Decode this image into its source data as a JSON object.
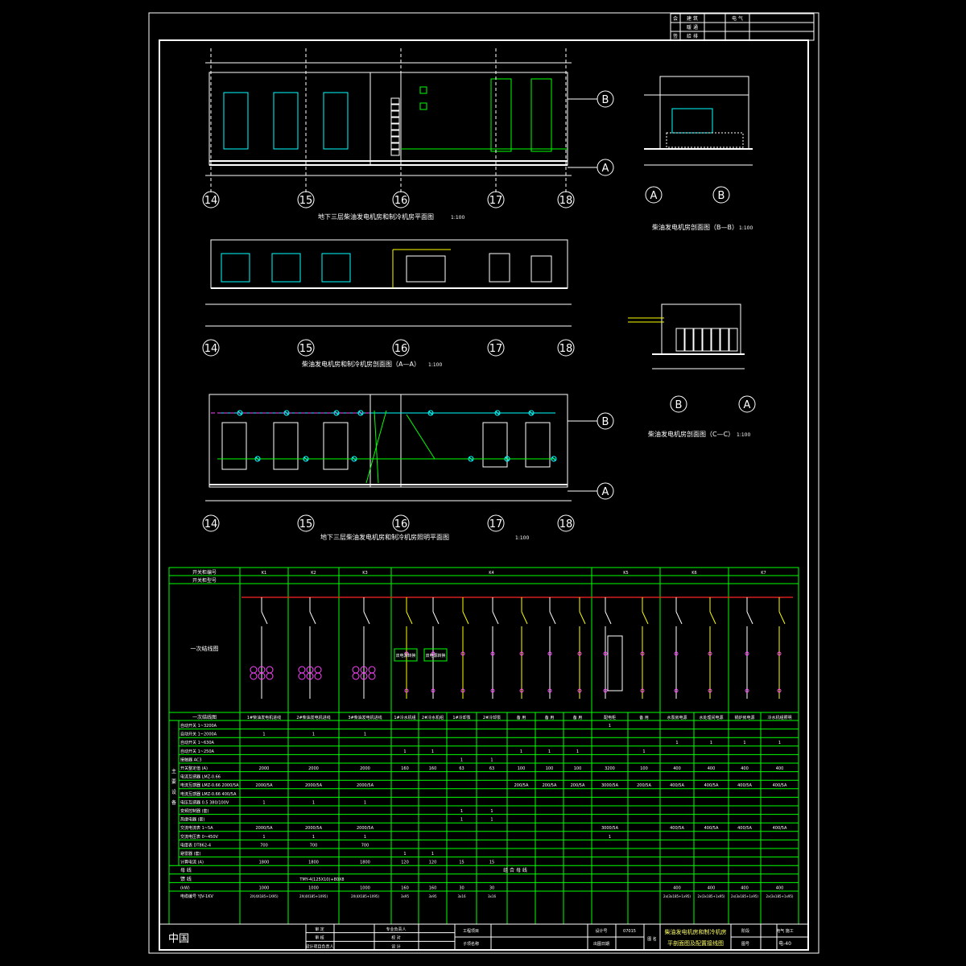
{
  "titles": {
    "plan": "地下三层柴油发电机房和制冷机房平面图",
    "plan_scale": "1:100",
    "section_aa": "柴油发电机房和制冷机房剖面图（A—A）",
    "section_aa_scale": "1:100",
    "section_bb": "柴油发电机房剖面图（B—B）",
    "section_bb_scale": "1:100",
    "section_cc": "柴油发电机房剖面图（C—C）",
    "section_cc_scale": "1:100",
    "lighting_plan": "地下三层柴油发电机房和制冷机房照明平面图",
    "lighting_plan_scale": "1:100"
  },
  "axes_numbers": [
    "14",
    "15",
    "16",
    "17",
    "18"
  ],
  "axes_letters_plan": [
    "B",
    "A"
  ],
  "axes_letters_bb": [
    "A",
    "B"
  ],
  "axes_letters_cc": [
    "B",
    "A"
  ],
  "top_stamp": {
    "rows": [
      [
        "会",
        "建 筑",
        "",
        "电 气",
        ""
      ],
      [
        "",
        "暖 通",
        "",
        "",
        ""
      ],
      [
        "签",
        "给 排",
        "",
        "",
        ""
      ]
    ]
  },
  "schedule": {
    "header_rows": [
      "开关柜编号",
      "开关柜型号"
    ],
    "cabinets": [
      "K1",
      "K2",
      "K3",
      "K4",
      "K5",
      "K6",
      "K7"
    ],
    "diagram_label": "一次结线图",
    "func_label": "一次结线图",
    "boxes": [
      "双电源转换",
      "双电源转换"
    ],
    "columns": [
      "1#柴油发电机进线",
      "2#柴油发电机进线",
      "3#柴油发电机进线",
      "1#冷水机组",
      "2#冷水机组",
      "1#冷却泵",
      "2#冷却泵",
      "备 用",
      "备 用",
      "备 用",
      "配电柜",
      "备 用",
      "水泵房电源",
      "水处理间电源",
      "锅炉房电源",
      "冷水机组照明"
    ],
    "row_group_label": "主要设备",
    "rows": [
      {
        "label": "自动开关 1~3200A",
        "vals": [
          "",
          "",
          "",
          "",
          "",
          "",
          "",
          "",
          "",
          "",
          "1",
          "",
          "",
          "",
          "",
          ""
        ]
      },
      {
        "label": "自动开关 1~2000A",
        "vals": [
          "1",
          "1",
          "1",
          "",
          "",
          "",
          "",
          "",
          "",
          "",
          "",
          "",
          "",
          "",
          "",
          ""
        ]
      },
      {
        "label": "自动开关 1~630A",
        "vals": [
          "",
          "",
          "",
          "",
          "",
          "",
          "",
          "",
          "",
          "",
          "",
          "",
          "1",
          "1",
          "1",
          "1"
        ]
      },
      {
        "label": "自动开关 1~250A",
        "vals": [
          "",
          "",
          "",
          "1",
          "1",
          "",
          "",
          "1",
          "1",
          "1",
          "",
          "1",
          "",
          "",
          "",
          ""
        ]
      },
      {
        "label": "接触器 AC3",
        "vals": [
          "",
          "",
          "",
          "",
          "",
          "1",
          "1",
          "",
          "",
          "",
          "",
          "",
          "",
          "",
          "",
          ""
        ]
      },
      {
        "label": "开关整定值 (A)",
        "vals": [
          "2000",
          "2000",
          "2000",
          "160",
          "160",
          "63",
          "63",
          "100",
          "100",
          "100",
          "3200",
          "100",
          "400",
          "400",
          "400",
          "400"
        ]
      },
      {
        "label": "电流互感器 LMZ-0.66",
        "vals": [
          "",
          "",
          "",
          "",
          "",
          "",
          "",
          "",
          "",
          "",
          "",
          "",
          "",
          "",
          "",
          ""
        ]
      },
      {
        "label": "电流互感器 LMZ-0.66 2000/5A",
        "vals": [
          "2000/5A",
          "2000/5A",
          "2000/5A",
          "",
          "",
          "",
          "",
          "200/5A",
          "200/5A",
          "200/5A",
          "3000/5A",
          "200/5A",
          "400/5A",
          "400/5A",
          "400/5A",
          "400/5A"
        ]
      },
      {
        "label": "电流互感器 LMZ-0.66 400/5A",
        "vals": [
          "",
          "",
          "",
          "",
          "",
          "",
          "",
          "",
          "",
          "",
          "",
          "",
          "",
          "",
          "",
          ""
        ]
      },
      {
        "label": "电压互感器 0.5 380/100V",
        "vals": [
          "1",
          "1",
          "1",
          "",
          "",
          "",
          "",
          "",
          "",
          "",
          "",
          "",
          "",
          "",
          "",
          ""
        ]
      },
      {
        "label": "变频控制器 (套)",
        "vals": [
          "",
          "",
          "",
          "",
          "",
          "1",
          "1",
          "",
          "",
          "",
          "",
          "",
          "",
          "",
          "",
          ""
        ]
      },
      {
        "label": "热继电器 (套)",
        "vals": [
          "",
          "",
          "",
          "",
          "",
          "1",
          "1",
          "",
          "",
          "",
          "",
          "",
          "",
          "",
          "",
          ""
        ]
      },
      {
        "label": "交流电流表 1~5A",
        "vals": [
          "2000/5A",
          "2000/5A",
          "2000/5A",
          "",
          "",
          "",
          "",
          "",
          "",
          "",
          "3000/5A",
          "",
          "400/5A",
          "400/5A",
          "400/5A",
          "400/5A"
        ]
      },
      {
        "label": "交流电压表 0~450V",
        "vals": [
          "1",
          "1",
          "1",
          "",
          "",
          "",
          "",
          "",
          "",
          "",
          "1",
          "",
          "",
          "",
          "",
          ""
        ]
      },
      {
        "label": "电度表 DT862-4",
        "vals": [
          "700",
          "700",
          "700",
          "",
          "",
          "",
          "",
          "",
          "",
          "",
          "",
          "",
          "",
          "",
          "",
          ""
        ]
      },
      {
        "label": "避雷器 (套)",
        "vals": [
          "",
          "",
          "",
          "1",
          "1",
          "",
          "",
          "",
          "",
          "",
          "",
          "",
          "",
          "",
          "",
          ""
        ]
      },
      {
        "label": "计算电流 (A)",
        "vals": [
          "1800",
          "1800",
          "1800",
          "120",
          "120",
          "15",
          "15",
          "",
          "",
          "",
          "",
          "",
          "",
          "",
          "",
          ""
        ]
      }
    ],
    "bus_row": {
      "label": "母 线",
      "value": "组 合 母 线"
    },
    "phase_row": {
      "label": "馈 线",
      "value": "TMY-4(125X10)+80X8"
    },
    "kw_row": {
      "label": "(kW)",
      "vals": [
        "1000",
        "1000",
        "1000",
        "160",
        "160",
        "30",
        "30",
        "",
        "",
        "",
        "",
        "",
        "400",
        "400",
        "400",
        "400"
      ]
    },
    "cable_row": {
      "label": "电缆编号 YJV-1KV",
      "vals": [
        "2X(4X185+1X95)",
        "2X(4X185+1X95)",
        "2X(4X185+1X95)",
        "3x95",
        "3x95",
        "3x16",
        "3x16",
        "",
        "",
        "",
        "",
        "",
        "2x(3x185+1x95)",
        "2x(3x185+1x95)",
        "2x(3x185+1x95)",
        "2x(3x185+1x95)"
      ]
    }
  },
  "title_block": {
    "logo": "中国",
    "rows": [
      [
        "审 定",
        "",
        "专业负责人",
        ""
      ],
      [
        "审 核",
        "",
        "校 对",
        ""
      ],
      [
        "设计项目负责人",
        "",
        "设 计",
        ""
      ]
    ],
    "project_label": "工程项目",
    "subproject_label": "子项名称",
    "design_no_label": "设计号",
    "design_no": "07015",
    "date_label": "出图日期",
    "fig_label": "图 名",
    "fig_title_1": "柴油发电机房和制冷机房",
    "fig_title_2": "平剖面图及配置接线图",
    "stage_label": "阶段",
    "stage_value": "电气 施工",
    "sheet_label": "图号",
    "sheet_value": "电-40"
  },
  "colors": {
    "background": "#000000",
    "line": "#ffffff",
    "green": "#00ff00",
    "cyan": "#00ffff",
    "yellow": "#ffff00",
    "magenta": "#ff44ff",
    "red": "#ff2222"
  }
}
